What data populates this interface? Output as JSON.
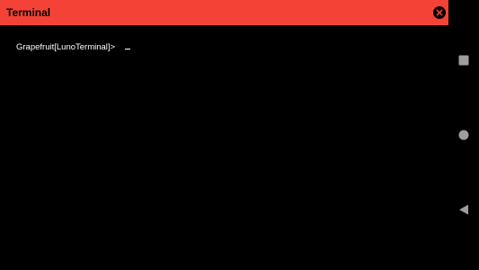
{
  "app": {
    "title": "Terminal",
    "accent_color": "#f44336",
    "close_icon": "close-circle-icon"
  },
  "terminal": {
    "prompt": "Grapefruit[LunoTerminal]>",
    "input": "",
    "cursor": "underscore",
    "text_color": "#ffffff",
    "background": "#000000"
  },
  "navbar": {
    "buttons": [
      {
        "name": "recent-apps",
        "icon": "square-icon"
      },
      {
        "name": "home",
        "icon": "circle-icon"
      },
      {
        "name": "back",
        "icon": "triangle-back-icon"
      }
    ],
    "icon_color": "#9e9e9e"
  }
}
